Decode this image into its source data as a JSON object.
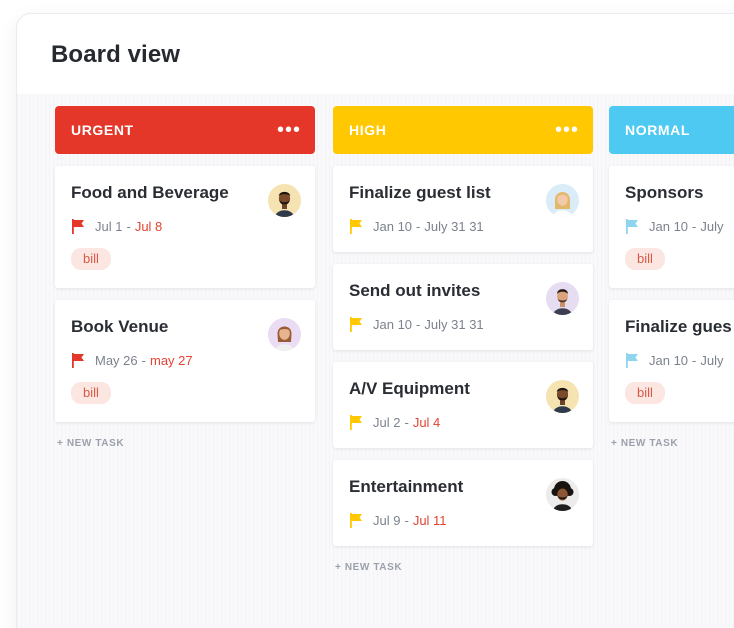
{
  "page": {
    "title": "Board view"
  },
  "colors": {
    "urgent": "#e4372a",
    "high": "#ffc800",
    "normal": "#4ec9f2",
    "overdue": "#e44332",
    "tag_bg": "#fbe6e2"
  },
  "columns": [
    {
      "title": "URGENT",
      "flag_color": "#e4372a",
      "menu": "•••",
      "new_task": "+ NEW TASK",
      "cards": [
        {
          "title": "Food and Beverage",
          "start": "Jul 1",
          "end": "Jul 8",
          "tag": "bill",
          "avatar": "avatar-man-beard-icon"
        },
        {
          "title": "Book Venue",
          "start": "May 26",
          "end": "may 27",
          "tag": "bill",
          "avatar": "avatar-woman-icon"
        }
      ]
    },
    {
      "title": "HIGH",
      "flag_color": "#ffc800",
      "menu": "•••",
      "new_task": "+ NEW TASK",
      "cards": [
        {
          "title": "Finalize guest list",
          "start": "Jan 10",
          "end": "July 31 31",
          "avatar": "avatar-woman-blonde-icon"
        },
        {
          "title": "Send out invites",
          "start": "Jan 10",
          "end": "July 31 31",
          "avatar": "avatar-man-purple-icon"
        },
        {
          "title": "A/V Equipment",
          "start": "Jul 2",
          "end": "Jul 4",
          "avatar": "avatar-man-beard-icon"
        },
        {
          "title": "Entertainment",
          "start": "Jul 9",
          "end": "Jul 11",
          "avatar": "avatar-man-curly-icon"
        }
      ]
    },
    {
      "title": "NORMAL",
      "flag_color": "#8fd5ee",
      "menu": "•••",
      "new_task": "+ NEW TASK",
      "cards": [
        {
          "title": "Sponsors",
          "start": "Jan 10",
          "end": "July",
          "tag": "bill"
        },
        {
          "title": "Finalize gues",
          "start": "Jan 10",
          "end": "July",
          "tag": "bill"
        }
      ]
    }
  ]
}
